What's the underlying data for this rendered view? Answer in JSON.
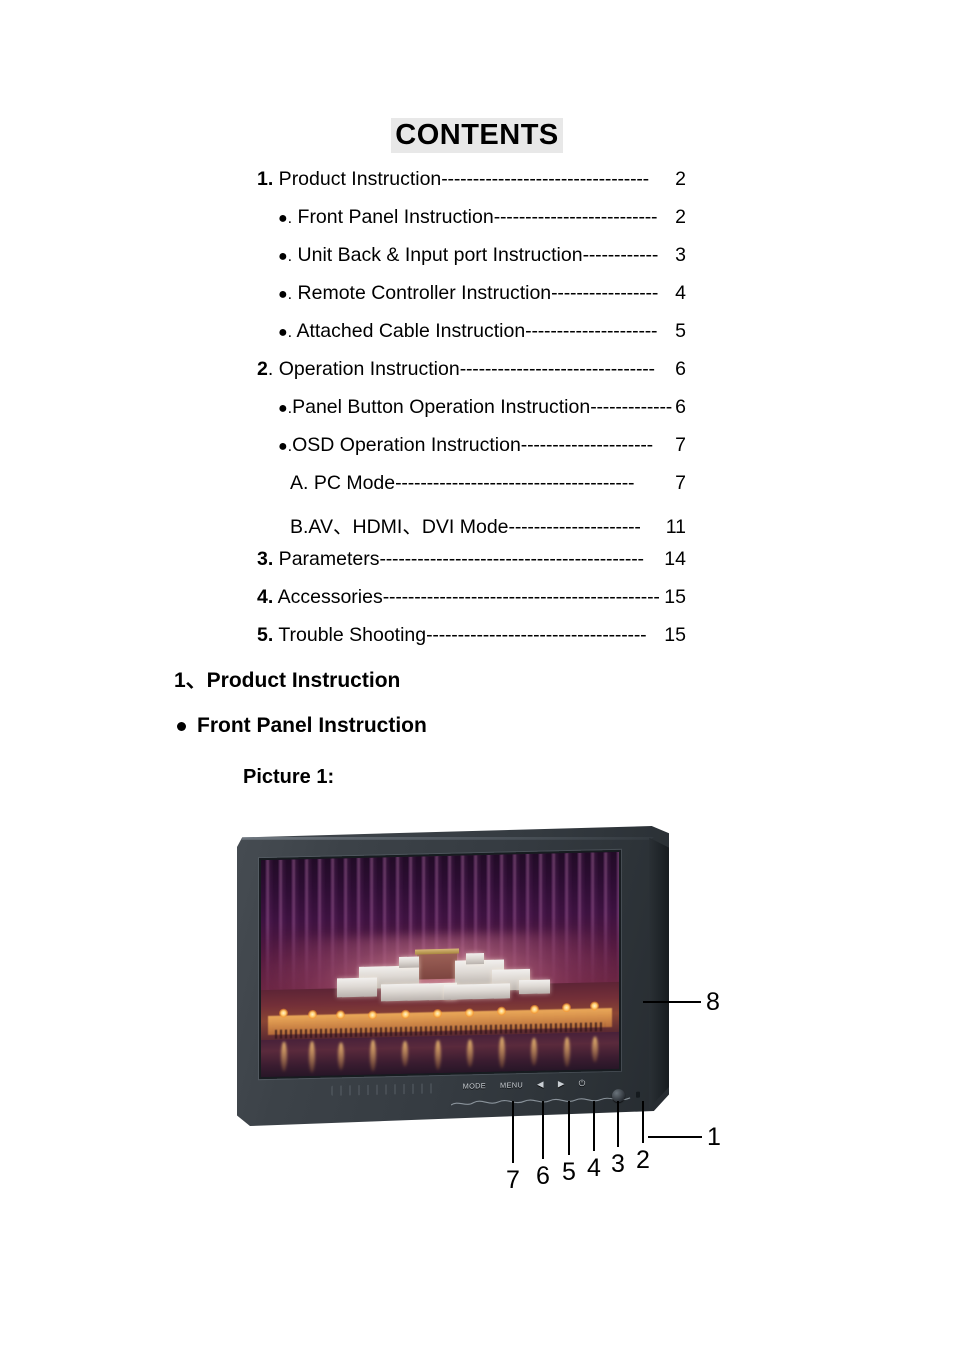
{
  "document": {
    "title": "CONTENTS",
    "toc": [
      {
        "marker": "1.",
        "marker_bold": true,
        "label": " Product Instruction",
        "leader": "---------------------------------",
        "page": " 2",
        "level": 1
      },
      {
        "marker": "●.",
        "marker_bold": false,
        "label": " Front Panel Instruction",
        "leader": "--------------------------",
        "page": " 2",
        "level": 2
      },
      {
        "marker": "●.",
        "marker_bold": false,
        "label": " Unit Back & Input port Instruction",
        "leader": "------------",
        "page": " 3",
        "level": 2
      },
      {
        "marker": "●.",
        "marker_bold": false,
        "label": " Remote Controller Instruction",
        "leader": "-----------------",
        "page": " 4",
        "level": 2
      },
      {
        "marker": "●.",
        "marker_bold": false,
        "label": " Attached Cable Instruction",
        "leader": "---------------------",
        "page": " 5",
        "level": 2
      },
      {
        "marker": "2",
        "marker_bold": true,
        "label": ". Operation Instruction",
        "leader": "-------------------------------",
        "page": "6",
        "level": 1
      },
      {
        "marker": "●.",
        "marker_bold": false,
        "label": "Panel Button Operation Instruction",
        "leader": "-------------",
        "page": "6",
        "level": 2
      },
      {
        "marker": "●.",
        "marker_bold": false,
        "label": "OSD Operation Instruction",
        "leader": "---------------------",
        "page": " 7",
        "level": 2
      },
      {
        "marker": "",
        "marker_bold": false,
        "label": "A. PC Mode ",
        "leader": "--------------------------------------",
        "page": " 7",
        "level": 3
      },
      {
        "marker": "",
        "marker_bold": false,
        "label": "B.AV、HDMI、DVI Mode ",
        "leader": "---------------------",
        "page": "11",
        "level": 3
      },
      {
        "marker": "3.",
        "marker_bold": true,
        "label": " Parameters ",
        "leader": "------------------------------------------",
        "page": "14",
        "level": 1
      },
      {
        "marker": "4.",
        "marker_bold": true,
        "label": " Accessories",
        "leader": "--------------------------------------------",
        "page": "15",
        "level": 1
      },
      {
        "marker": "5.",
        "marker_bold": true,
        "label": " Trouble Shooting ",
        "leader": "-----------------------------------",
        "page": "15",
        "level": 1
      }
    ],
    "headings": {
      "section_1": "1、Product Instruction",
      "subsection_1": "Front Panel Instruction",
      "picture_caption": "Picture 1:"
    }
  },
  "figure": {
    "name": "front-panel-monitor-photo",
    "screen_image_subject": "Potala Palace illuminated at night",
    "panel_buttons": [
      {
        "label": "MODE",
        "callout": "7"
      },
      {
        "label": "MENU",
        "callout": "6"
      },
      {
        "label": "◀",
        "callout": "5"
      },
      {
        "label": "▶",
        "callout": "4"
      },
      {
        "label": "⏻",
        "callout": "3"
      }
    ],
    "callouts": [
      {
        "number": "8",
        "target": "lcd-screen"
      },
      {
        "number": "1",
        "target": "ir-sensor"
      },
      {
        "number": "2",
        "target": "power-indicator"
      },
      {
        "number": "3",
        "target": "power-button"
      },
      {
        "number": "4",
        "target": "right-button"
      },
      {
        "number": "5",
        "target": "left-button"
      },
      {
        "number": "6",
        "target": "menu-button"
      },
      {
        "number": "7",
        "target": "mode-button"
      }
    ],
    "bottom_callout_numbers": [
      "7",
      "6",
      "5",
      "4",
      "3",
      "2"
    ]
  },
  "colors": {
    "bezel": "#3a4046",
    "bezel_dark": "#262b30",
    "title_highlight": "#e8e8e8",
    "screen_sky": "#3d1240",
    "screen_glow": "#f3b25c",
    "text": "#000000"
  }
}
